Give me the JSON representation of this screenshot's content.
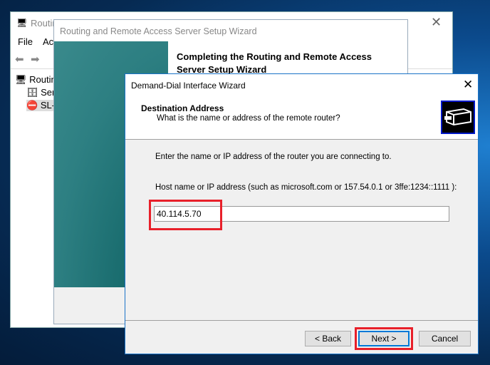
{
  "mmc": {
    "title": "Routing and Remote Access",
    "menu": [
      "File",
      "Action"
    ],
    "tree": [
      "Routing and Remote Access",
      "Server Status",
      "SL-"
    ]
  },
  "setup_wizard": {
    "title": "Routing and Remote Access Server Setup Wizard",
    "heading": "Completing the Routing and Remote Access Server Setup Wizard"
  },
  "dialog": {
    "title": "Demand-Dial Interface Wizard",
    "header_title": "Destination Address",
    "header_subtitle": "What is the name or address of the remote router?",
    "instruction": "Enter the name or IP address of the router you are connecting to.",
    "host_label": "Host name or IP address (such as microsoft.com or 157.54.0.1 or 3ffe:1234::1111 ):",
    "host_value": "40.114.5.70",
    "back_label": "< Back",
    "next_label": "Next >",
    "cancel_label": "Cancel"
  },
  "colors": {
    "highlight": "#e8202a",
    "accent": "#0078d7"
  }
}
